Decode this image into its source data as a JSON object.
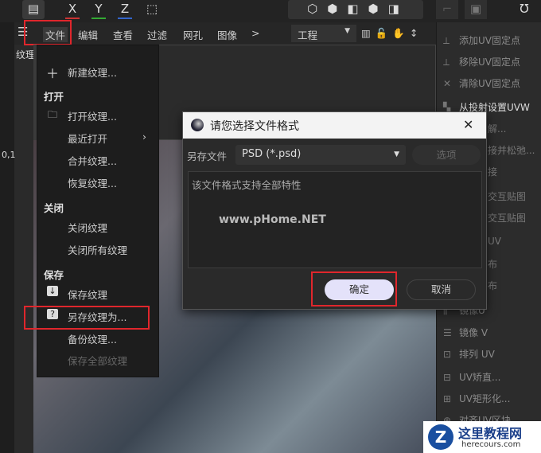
{
  "toolbar": {
    "axes": [
      "X",
      "Y",
      "Z"
    ]
  },
  "menubar": {
    "items": [
      "文件",
      "编辑",
      "查看",
      "过滤",
      "网孔",
      "图像"
    ],
    "more": ">",
    "mode": "工程"
  },
  "panel_tab": "纹理",
  "coord": "0,1",
  "file_menu": {
    "new": "新建纹理...",
    "sections": {
      "open": "打开",
      "close": "关闭",
      "save": "保存"
    },
    "open_items": [
      "打开纹理...",
      "最近打开",
      "合并纹理...",
      "恢复纹理..."
    ],
    "close_items": [
      "关闭纹理",
      "关闭所有纹理"
    ],
    "save_items": [
      "保存纹理",
      "另存纹理为...",
      "备份纹理...",
      "保存全部纹理"
    ]
  },
  "right_panel": {
    "items": [
      "添加UV固定点",
      "移除UV固定点",
      "清除UV固定点",
      "从投射设置UVW",
      "解...",
      "接并松弛...",
      "接",
      "交互贴图",
      "交互贴图",
      "UV",
      "布",
      "布",
      "镜像U",
      "镜像 V",
      "排列 UV",
      "UV矫直...",
      "UV矩形化...",
      "对齐UV区块"
    ]
  },
  "dialog": {
    "title": "请您选择文件格式",
    "label": "另存文件",
    "format": "PSD (*.psd)",
    "options": "选项",
    "info": "该文件格式支持全部特性",
    "watermark_text": "www.pHome.NET",
    "ok": "确定",
    "cancel": "取消",
    "close": "✕"
  },
  "watermark": {
    "title": "这里教程网",
    "url": "herecours.com"
  }
}
